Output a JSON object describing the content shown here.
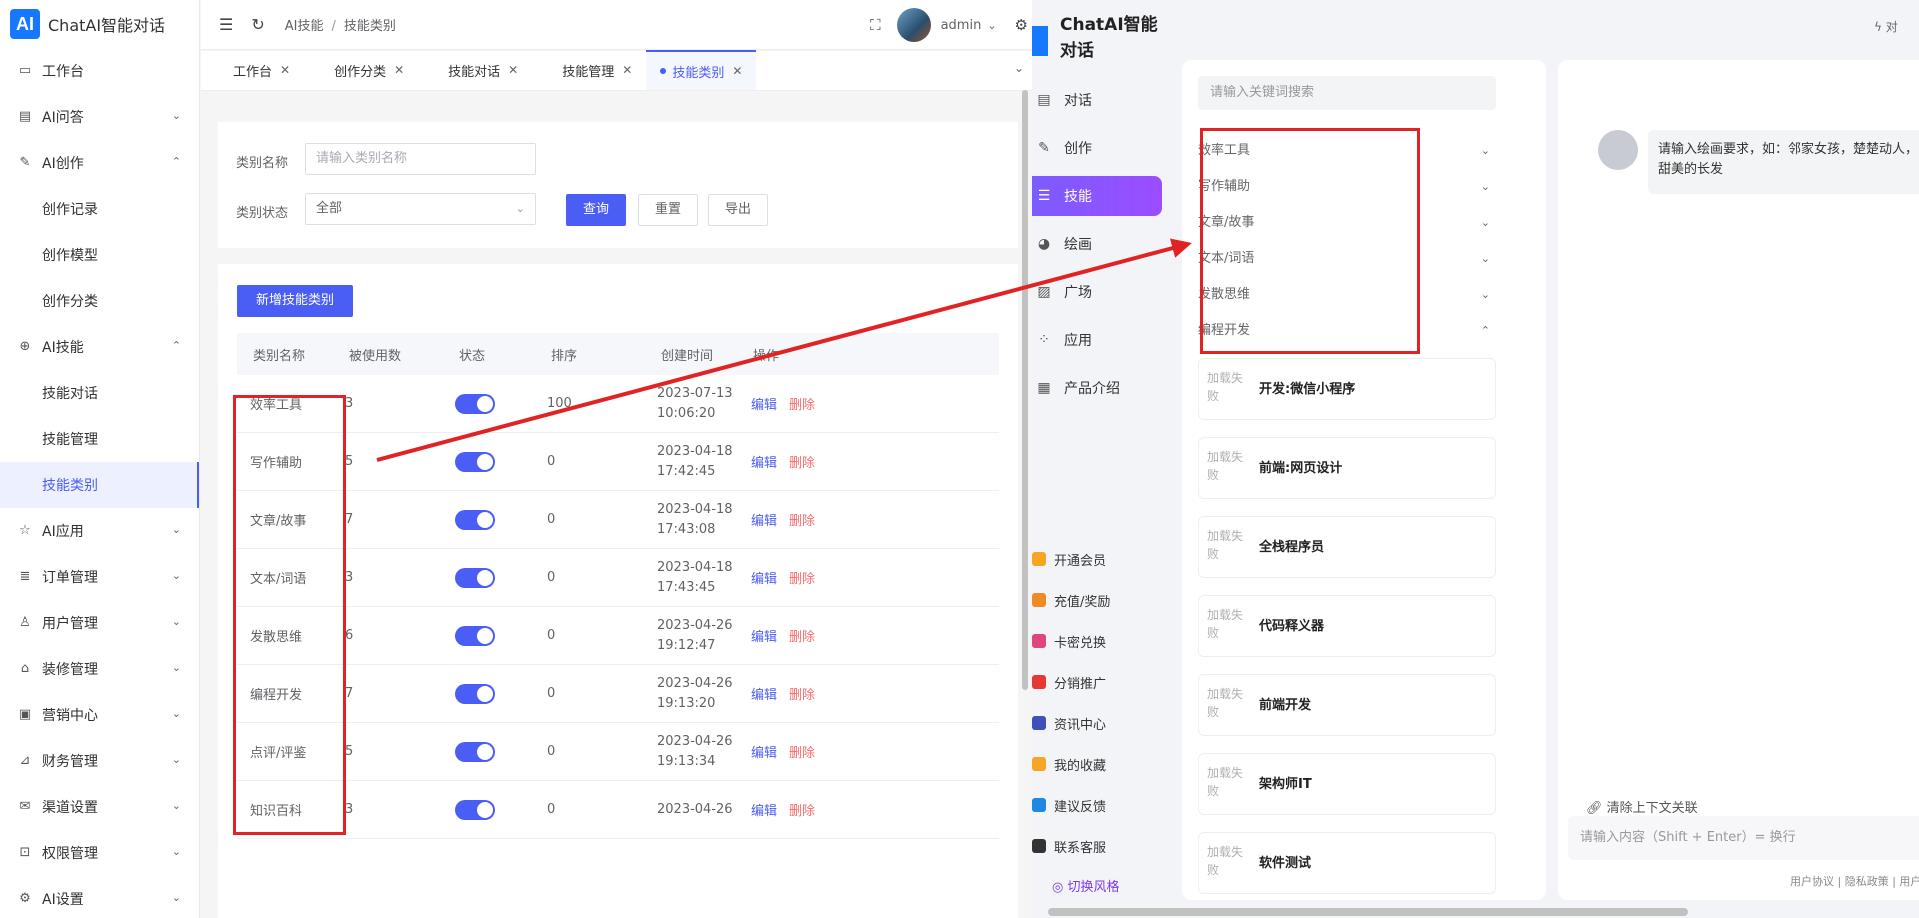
{
  "admin": {
    "logo": {
      "mark": "AI",
      "title": "ChatAI智能对话"
    },
    "sidebar": [
      {
        "label": "工作台",
        "icon": "monitor-icon",
        "glyph": "▭",
        "chev": ""
      },
      {
        "label": "AI问答",
        "icon": "chat-icon",
        "glyph": "▤",
        "chev": "⌄"
      },
      {
        "label": "AI创作",
        "icon": "pen-icon",
        "glyph": "✎",
        "chev": "⌃"
      },
      {
        "label": "创作记录",
        "sub": true
      },
      {
        "label": "创作模型",
        "sub": true
      },
      {
        "label": "创作分类",
        "sub": true
      },
      {
        "label": "AI技能",
        "icon": "target-icon",
        "glyph": "⊕",
        "chev": "⌃"
      },
      {
        "label": "技能对话",
        "sub": true
      },
      {
        "label": "技能管理",
        "sub": true
      },
      {
        "label": "技能类别",
        "sub": true,
        "active": true
      },
      {
        "label": "AI应用",
        "icon": "star-icon",
        "glyph": "☆",
        "chev": "⌄"
      },
      {
        "label": "订单管理",
        "icon": "database-icon",
        "glyph": "≣",
        "chev": "⌄"
      },
      {
        "label": "用户管理",
        "icon": "user-icon",
        "glyph": "♙",
        "chev": "⌄"
      },
      {
        "label": "装修管理",
        "icon": "store-icon",
        "glyph": "⌂",
        "chev": "⌄"
      },
      {
        "label": "营销中心",
        "icon": "briefcase-icon",
        "glyph": "▣",
        "chev": "⌄"
      },
      {
        "label": "财务管理",
        "icon": "chart-icon",
        "glyph": "⊿",
        "chev": "⌄"
      },
      {
        "label": "渠道设置",
        "icon": "mail-icon",
        "glyph": "✉",
        "chev": "⌄"
      },
      {
        "label": "权限管理",
        "icon": "lock-icon",
        "glyph": "⊡",
        "chev": "⌄"
      },
      {
        "label": "AI设置",
        "icon": "gear-icon",
        "glyph": "⚙",
        "chev": "⌄"
      }
    ],
    "topbar": {
      "breadcrumb": [
        "AI技能",
        "技能类别"
      ],
      "user": "admin"
    },
    "tabs": [
      {
        "label": "工作台",
        "active": false
      },
      {
        "label": "创作分类",
        "active": false
      },
      {
        "label": "技能对话",
        "active": false
      },
      {
        "label": "技能管理",
        "active": false
      },
      {
        "label": "技能类别",
        "active": true
      }
    ],
    "filter": {
      "name_label": "类别名称",
      "name_placeholder": "请输入类别名称",
      "status_label": "类别状态",
      "status_value": "全部",
      "query": "查询",
      "reset": "重置",
      "export": "导出"
    },
    "add_button": "新增技能类别",
    "table": {
      "headers": [
        "类别名称",
        "被使用数",
        "状态",
        "排序",
        "创建时间",
        "操作"
      ],
      "edit_label": "编辑",
      "delete_label": "删除",
      "rows": [
        {
          "name": "效率工具",
          "used": "3",
          "enabled": true,
          "sort": "100",
          "date": "2023-07-13",
          "time": "10:06:20"
        },
        {
          "name": "写作辅助",
          "used": "5",
          "enabled": true,
          "sort": "0",
          "date": "2023-04-18",
          "time": "17:42:45"
        },
        {
          "name": "文章/故事",
          "used": "7",
          "enabled": true,
          "sort": "0",
          "date": "2023-04-18",
          "time": "17:43:08"
        },
        {
          "name": "文本/词语",
          "used": "3",
          "enabled": true,
          "sort": "0",
          "date": "2023-04-18",
          "time": "17:43:45"
        },
        {
          "name": "发散思维",
          "used": "6",
          "enabled": true,
          "sort": "0",
          "date": "2023-04-26",
          "time": "19:12:47"
        },
        {
          "name": "编程开发",
          "used": "7",
          "enabled": true,
          "sort": "0",
          "date": "2023-04-26",
          "time": "19:13:20"
        },
        {
          "name": "点评/评鉴",
          "used": "5",
          "enabled": true,
          "sort": "0",
          "date": "2023-04-26",
          "time": "19:13:34"
        },
        {
          "name": "知识百科",
          "used": "3",
          "enabled": true,
          "sort": "0",
          "date": "2023-04-26",
          "time": ""
        }
      ]
    }
  },
  "chat": {
    "logo": {
      "mark": "AI",
      "title": "ChatAI智能对话"
    },
    "nav": [
      {
        "label": "对话",
        "icon": "chat-bubble-icon",
        "glyph": "▤"
      },
      {
        "label": "创作",
        "icon": "edit-icon",
        "glyph": "✎"
      },
      {
        "label": "技能",
        "icon": "list-icon",
        "glyph": "☰",
        "active": true
      },
      {
        "label": "绘画",
        "icon": "palette-icon",
        "glyph": "◕"
      },
      {
        "label": "广场",
        "icon": "image-icon",
        "glyph": "▨"
      },
      {
        "label": "应用",
        "icon": "apps-icon",
        "glyph": "⁘"
      },
      {
        "label": "产品介绍",
        "icon": "doc-icon",
        "glyph": "▦"
      }
    ],
    "extras": [
      {
        "label": "开通会员",
        "icon": "vip-icon",
        "color": "#f5a623"
      },
      {
        "label": "充值/奖励",
        "icon": "coin-icon",
        "color": "#f08a24"
      },
      {
        "label": "卡密兑换",
        "icon": "card-icon",
        "color": "#e0457b"
      },
      {
        "label": "分销推广",
        "icon": "share-icon",
        "color": "#e53935"
      },
      {
        "label": "资讯中心",
        "icon": "news-icon",
        "color": "#3f51b5"
      },
      {
        "label": "我的收藏",
        "icon": "star-fav-icon",
        "color": "#f5a623"
      },
      {
        "label": "建议反馈",
        "icon": "feedback-icon",
        "color": "#1e88e5"
      },
      {
        "label": "联系客服",
        "icon": "headset-icon",
        "color": "#333333"
      }
    ],
    "switch_style": "切换风格",
    "search_placeholder": "请输入关键词搜索",
    "categories": [
      {
        "label": "效率工具",
        "chev": "⌄"
      },
      {
        "label": "写作辅助",
        "chev": "⌄"
      },
      {
        "label": "文章/故事",
        "chev": "⌄"
      },
      {
        "label": "文本/词语",
        "chev": "⌄"
      },
      {
        "label": "发散思维",
        "chev": "⌄"
      },
      {
        "label": "编程开发",
        "chev": "⌃"
      }
    ],
    "skill_img_text": "加载失败",
    "skills": [
      "开发:微信小程序",
      "前端:网页设计",
      "全栈程序员",
      "代码释义器",
      "前端开发",
      "架构师IT",
      "软件测试"
    ],
    "bubble": "请输入绘画要求，如：邻家女孩，楚楚动人，甜美的长发",
    "clear_context": "清除上下文关联",
    "input_placeholder": "请输入内容（Shift + Enter）= 换行",
    "footer": "用户协议 | 隐私政策 | 用户文",
    "top_right": "对"
  },
  "annotation": {
    "color": "#e02424"
  }
}
